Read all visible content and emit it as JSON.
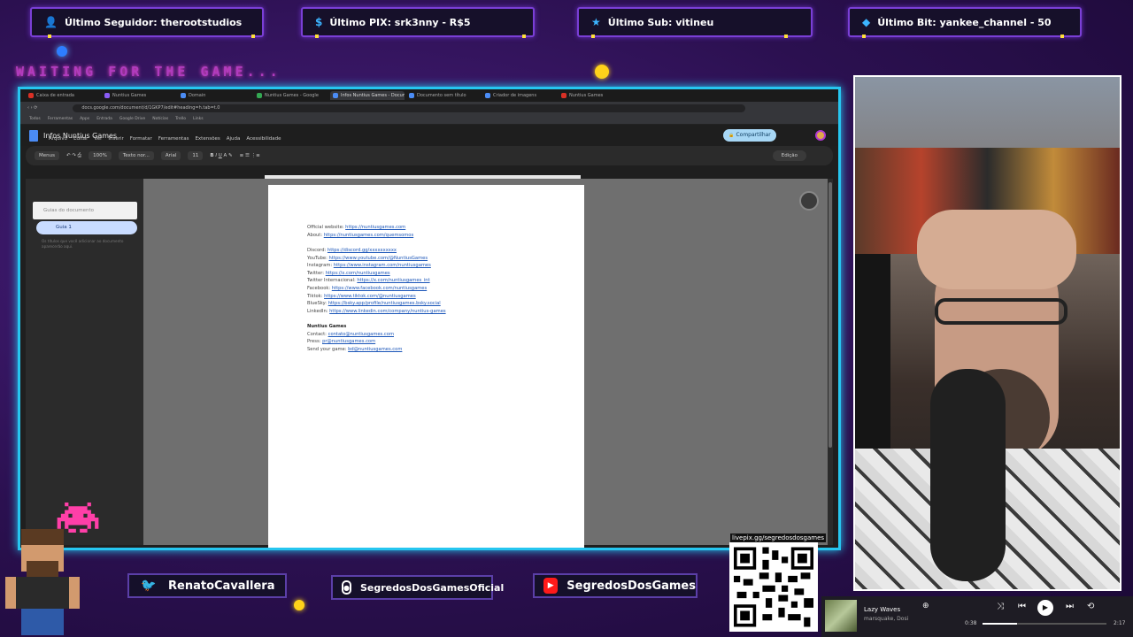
{
  "alerts": [
    {
      "icon": "user-icon",
      "text": "Último Seguidor: therootstudios"
    },
    {
      "icon": "dollar-icon",
      "text": "Último PIX: srk3nny - R$5"
    },
    {
      "icon": "star-icon",
      "text": "Último Sub: vitineu"
    },
    {
      "icon": "diamond-icon",
      "text": "Último Bit: yankee_channel - 50"
    }
  ],
  "waiting": "WAITING FOR THE GAME...",
  "browser": {
    "tabs": [
      "Caixa de entrada",
      "Nuntius Games",
      "Domain",
      "Nuntius Games - Google",
      "Infos Nuntius Games - Documentos",
      "Documento sem título",
      "Criador de imagens",
      "Nuntius Games"
    ],
    "url": "docs.google.com/document/d/1GKP7/edit#heading=h.tab=t.0",
    "bookmarks": [
      "Todos",
      "Ferramentas",
      "Apps",
      "Entrada",
      "Google Drive",
      "Notícias",
      "Trello",
      "Links"
    ],
    "doc_title": "Infos Nuntius Games",
    "menu": [
      "Arquivo",
      "Editar",
      "Ver",
      "Inserir",
      "Formatar",
      "Ferramentas",
      "Extensões",
      "Ajuda",
      "Acessibilidade"
    ],
    "share_label": "Compartilhar",
    "toolbar": {
      "search": "Menus",
      "zoom": "100%",
      "style": "Texto nor...",
      "font": "Arial",
      "size": "11",
      "mode": "Edição"
    },
    "sidebar": {
      "title": "Guias do documento",
      "tab": "Guia 1",
      "note": "Os títulos que você adicionar ao documento aparecerão aqui."
    }
  },
  "doc_lines": [
    {
      "label": "Official website: ",
      "link": "https://nuntiusgames.com"
    },
    {
      "label": "About: ",
      "link": "https://nuntiusgames.com/quemsomos"
    },
    {
      "label": "Discord: ",
      "link": "https://discord.gg/xxxxxxxxxx"
    },
    {
      "label": "YouTube: ",
      "link": "https://www.youtube.com/@NuntiusGames"
    },
    {
      "label": "Instagram: ",
      "link": "https://www.instagram.com/nuntiusgames"
    },
    {
      "label": "Twitter: ",
      "link": "https://x.com/nuntiusgames"
    },
    {
      "label": "Twitter Internacional: ",
      "link": "https://x.com/nuntiusgames_int"
    },
    {
      "label": "Facebook: ",
      "link": "https://www.facebook.com/nuntiusgames"
    },
    {
      "label": "Tiktok: ",
      "link": "https://www.tiktok.com/@nuntiusgames"
    },
    {
      "label": "BlueSky: ",
      "link": "https://bsky.app/profile/nuntiusgames.bsky.social"
    },
    {
      "label": "LinkedIn: ",
      "link": "https://www.linkedin.com/company/nuntius-games"
    },
    {
      "label": "Nuntius Games",
      "link": ""
    },
    {
      "label": "Contact: ",
      "link": "contato@nuntiusgames.com"
    },
    {
      "label": "Press: ",
      "link": "pr@nuntiusgames.com"
    },
    {
      "label": "Send your game: ",
      "link": "bd@nuntiusgames.com"
    }
  ],
  "socials": [
    {
      "icon": "twitter-icon",
      "name": "RenatoCavallera"
    },
    {
      "icon": "instagram-icon",
      "name": "SegredosDosGamesOficial"
    },
    {
      "icon": "youtube-icon",
      "name": "SegredosDosGames"
    }
  ],
  "qr_label": "livepix.gg/segredosdosgames",
  "player": {
    "title": "Lazy Waves",
    "artist": "marsquake, Dosi",
    "elapsed": "0:38",
    "total": "2:17",
    "progress": 0.28
  },
  "colors": {
    "frame": "#26c6f0",
    "accent": "#7a3fd6",
    "waiting": "#b13cbf"
  }
}
